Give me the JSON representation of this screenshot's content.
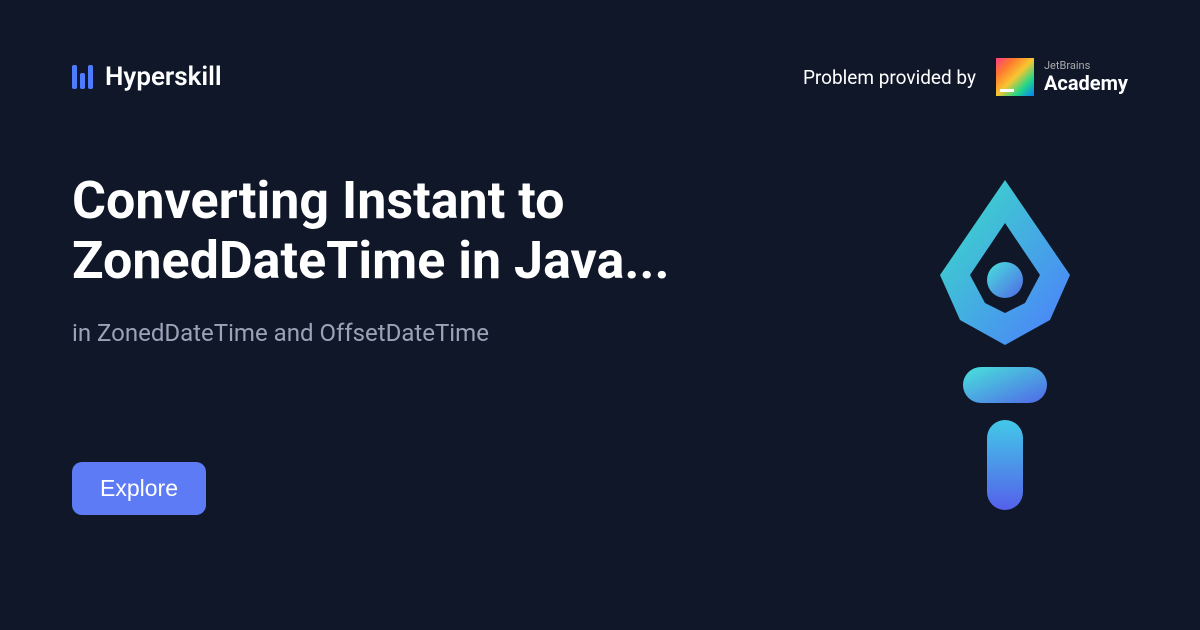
{
  "header": {
    "brand": "Hyperskill",
    "provided_label": "Problem provided by",
    "partner_small": "JetBrains",
    "partner_large": "Academy"
  },
  "main": {
    "title": "Converting Instant to ZonedDateTime in Java...",
    "subtitle": "in ZonedDateTime and OffsetDateTime",
    "cta_label": "Explore"
  }
}
